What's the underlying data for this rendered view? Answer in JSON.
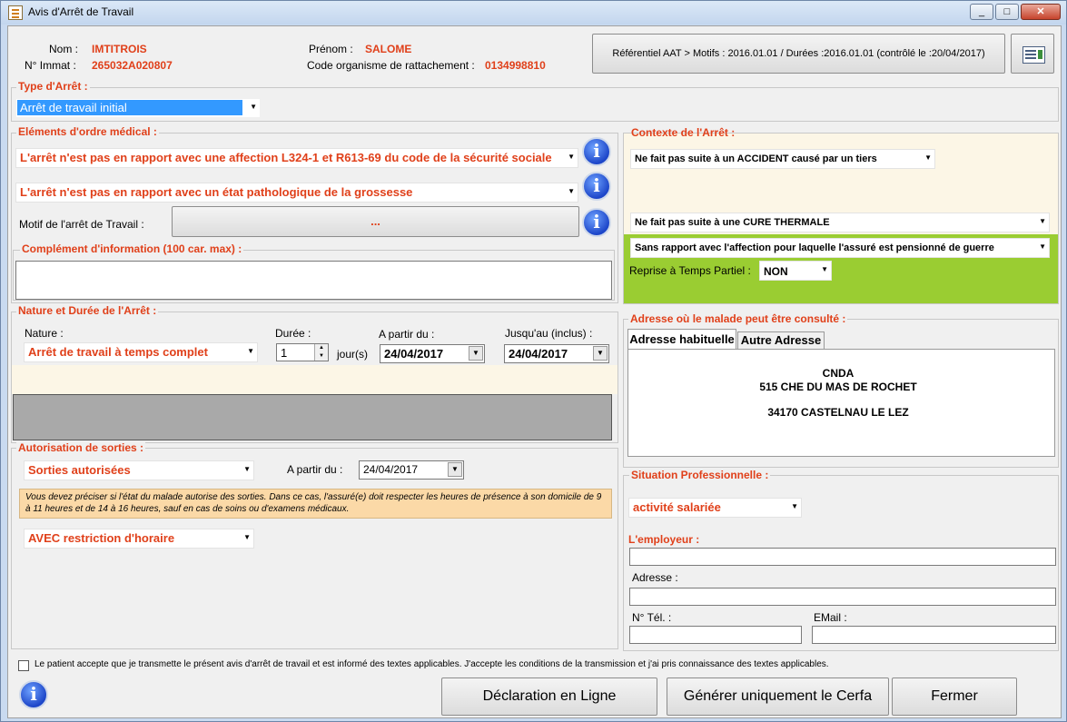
{
  "window": {
    "title": "Avis d'Arrêt de Travail",
    "min": "_",
    "max": "□",
    "close": "✕"
  },
  "header": {
    "nom_label": "Nom :",
    "nom": "IMTITROIS",
    "immat_label": "N° Immat :",
    "immat": "265032A020807",
    "prenom_label": "Prénom :",
    "prenom": "SALOME",
    "code_label": "Code organisme de rattachement :",
    "code": "0134998810",
    "referentiel": "Référentiel AAT > Motifs : 2016.01.01 / Durées :2016.01.01 (contrôlé le :20/04/2017)"
  },
  "type_arret": {
    "title": "Type d'Arrêt :",
    "value": "Arrêt de travail initial"
  },
  "medical": {
    "title": "Eléments d'ordre médical :",
    "affection": "L'arrêt n'est pas en rapport avec une affection L324-1 et R613-69 du code de la sécurité sociale",
    "grossesse": "L'arrêt n'est pas en rapport avec un état pathologique de la grossesse",
    "motif_label": "Motif de l'arrêt de Travail :",
    "motif_button": "...",
    "complement_title": "Complément d'information (100 car. max) :",
    "complement_value": ""
  },
  "contexte": {
    "title": "Contexte de l'Arrêt :",
    "accident": "Ne fait pas suite à un ACCIDENT causé par un tiers",
    "cure": "Ne fait pas suite à une CURE THERMALE",
    "guerre": "Sans rapport avec l'affection pour laquelle l'assuré est pensionné de guerre",
    "reprise_label": "Reprise à Temps Partiel :",
    "reprise_value": "NON"
  },
  "nature": {
    "title": "Nature et Durée de l'Arrêt :",
    "nature_label": "Nature :",
    "nature_value": "Arrêt de travail à temps complet",
    "duree_label": "Durée :",
    "duree_value": "1",
    "duree_unit": "jour(s)",
    "from_label": "A partir du :",
    "from_value": "24/04/2017",
    "to_label": "Jusqu'au (inclus) :",
    "to_value": "24/04/2017"
  },
  "sorties": {
    "title": "Autorisation de sorties :",
    "value": "Sorties autorisées",
    "from_label": "A partir du :",
    "from_value": "24/04/2017",
    "note": "Vous devez préciser si l'état du malade autorise des sorties. Dans ce cas, l'assuré(e) doit respecter les heures de présence à son domicile de 9 à 11 heures et de 14 à 16 heures, sauf en cas de soins ou d'examens médicaux.",
    "restriction": "AVEC restriction d'horaire"
  },
  "adresse": {
    "title": "Adresse où le malade peut être consulté :",
    "tabs": [
      "Adresse habituelle",
      "Autre Adresse"
    ],
    "line1": "CNDA",
    "line2": "515 CHE DU MAS DE ROCHET",
    "line3": "34170 CASTELNAU LE LEZ"
  },
  "situation": {
    "title": "Situation Professionnelle :",
    "value": "activité salariée",
    "employeur_label": "L'employeur :",
    "employeur": "",
    "adresse_label": "Adresse :",
    "adresse": "",
    "tel_label": "N° Tél. :",
    "tel": "",
    "email_label": "EMail :",
    "email": ""
  },
  "footer": {
    "consent": "Le patient accepte que je transmette le présent avis d'arrêt de travail et est informé des textes applicables. J'accepte les conditions de la transmission et j'ai pris connaissance des textes applicables.",
    "btn_declaration": "Déclaration en Ligne",
    "btn_cerfa": "Générer uniquement le Cerfa",
    "btn_fermer": "Fermer"
  },
  "icons": {
    "info": "i",
    "dropdown": "▼"
  }
}
